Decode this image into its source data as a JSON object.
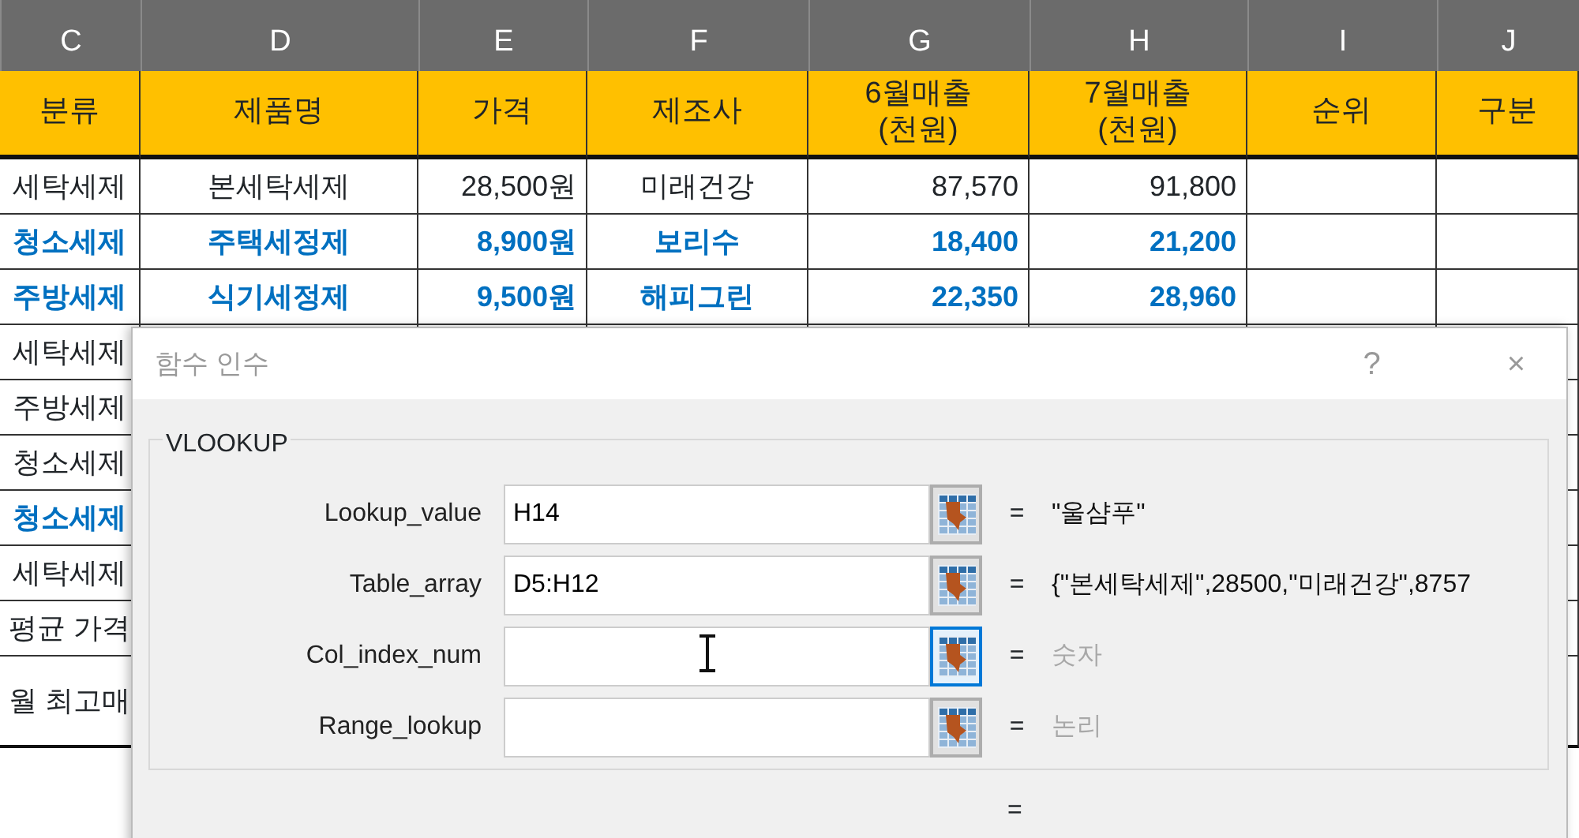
{
  "sheet": {
    "column_letters": [
      "C",
      "D",
      "E",
      "F",
      "G",
      "H",
      "I",
      "J"
    ],
    "header": [
      "분류",
      "제품명",
      "가격",
      "제조사",
      "6월매출\n(천원)",
      "7월매출\n(천원)",
      "순위",
      "구분"
    ],
    "rows": [
      {
        "highlight": false,
        "cells": [
          "세탁세제",
          "본세탁세제",
          "28,500원",
          "미래건강",
          "87,570",
          "91,800"
        ]
      },
      {
        "highlight": true,
        "cells": [
          "청소세제",
          "주택세정제",
          "8,900원",
          "보리수",
          "18,400",
          "21,200"
        ]
      },
      {
        "highlight": true,
        "cells": [
          "주방세제",
          "식기세정제",
          "9,500원",
          "해피그린",
          "22,350",
          "28,960"
        ]
      },
      {
        "highlight": false,
        "cells": [
          "세탁세제"
        ]
      },
      {
        "highlight": false,
        "cells": [
          "주방세제"
        ]
      },
      {
        "highlight": false,
        "cells": [
          "청소세제"
        ]
      },
      {
        "highlight": true,
        "cells": [
          "청소세제"
        ]
      },
      {
        "highlight": false,
        "cells": [
          "세탁세제"
        ]
      },
      {
        "highlight": false,
        "cells": [
          "평균 가격"
        ]
      },
      {
        "highlight": false,
        "tall": true,
        "cells": [
          "월 최고매"
        ]
      }
    ]
  },
  "dialog": {
    "title": "함수 인수",
    "help": "?",
    "close": "×",
    "function_name": "VLOOKUP",
    "arguments": [
      {
        "label": "Lookup_value",
        "value": "H14",
        "equals": "=",
        "focused": false,
        "result": "\"울샴푸\"",
        "muted": false
      },
      {
        "label": "Table_array",
        "value": "D5:H12",
        "equals": "=",
        "focused": false,
        "result": "{\"본세탁세제\",28500,\"미래건강\",8757",
        "muted": false
      },
      {
        "label": "Col_index_num",
        "equals": "=",
        "focused": true,
        "result": "숫자",
        "muted": true
      },
      {
        "label": "Range_lookup",
        "equals": "=",
        "focused": false,
        "result": "논리",
        "muted": true
      }
    ],
    "formula_result": "="
  }
}
